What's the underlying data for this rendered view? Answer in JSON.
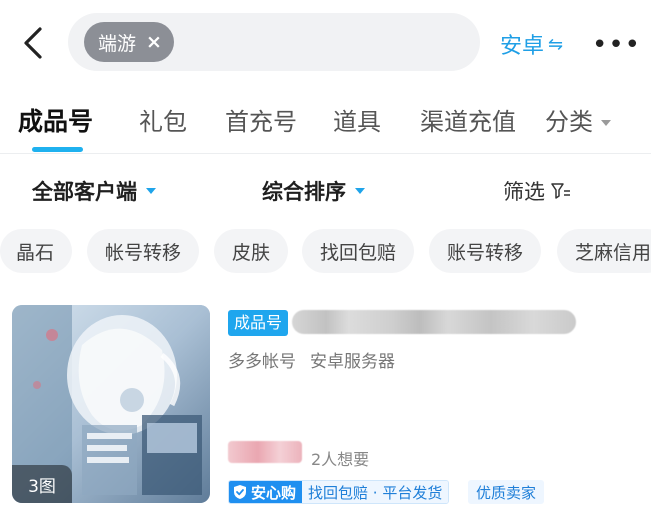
{
  "search": {
    "chip_label": "端游",
    "chip_close": "×"
  },
  "header": {
    "platform_label": "安卓",
    "platform_switch_icon": "⇋",
    "more_label": "•••"
  },
  "tabs": [
    {
      "label": "成品号",
      "active": true
    },
    {
      "label": "礼包"
    },
    {
      "label": "首充号"
    },
    {
      "label": "道具"
    },
    {
      "label": "渠道充值"
    },
    {
      "label": "分类"
    }
  ],
  "filters": {
    "client": "全部客户端",
    "sort": "综合排序",
    "screen": "筛选"
  },
  "tags": [
    "晶石",
    "帐号转移",
    "皮肤",
    "找回包赔",
    "账号转移",
    "芝麻信用"
  ],
  "listing": {
    "image_count": "3图",
    "type_badge": "成品号",
    "meta": [
      "多多帐号",
      "安卓服务器"
    ],
    "wants": "2人想要",
    "assure_brand": "安心购",
    "assure_text": "找回包赔 · 平台发货",
    "seller_tag": "优质卖家"
  },
  "colors": {
    "accent": "#1fa6ee",
    "assure": "#1f8ff0"
  }
}
